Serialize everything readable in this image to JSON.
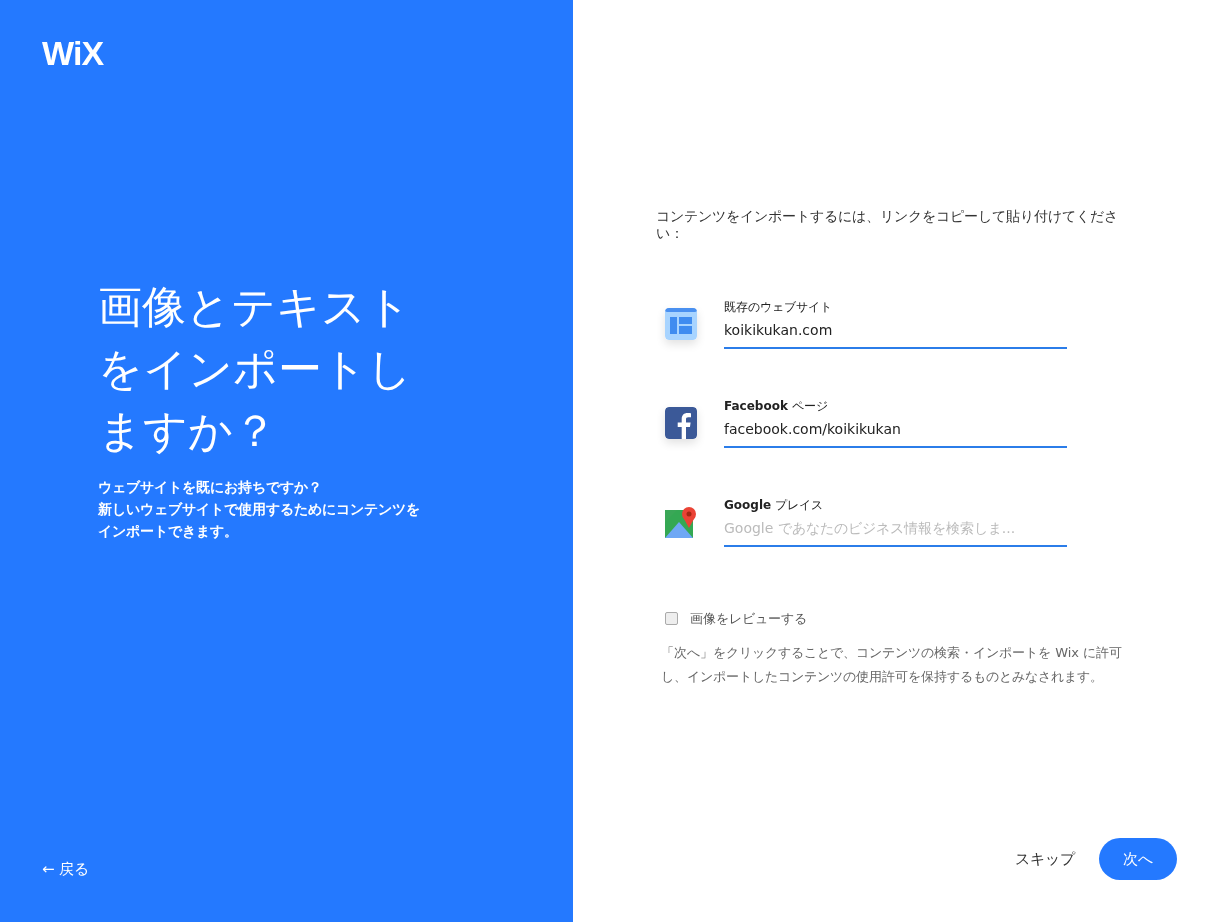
{
  "left_panel": {
    "logo": "WiX",
    "title": "画像とテキストをインポートしますか？",
    "subtitle": [
      "ウェブサイトを既にお持ちですか？",
      "新しいウェブサイトで使用するためにコンテンツを",
      "インポートできます。"
    ],
    "back_link": "← 戻る"
  },
  "right_panel": {
    "instruction": "コンテンツをインポートするには、リンクをコピーして貼り付けてください：",
    "fields": [
      {
        "kind": "website",
        "label": "既存のウェブサイト",
        "value": "koikikukan.com"
      },
      {
        "kind": "facebook",
        "label": "**Facebook** ページ",
        "value": "facebook.com/koikikukan"
      },
      {
        "kind": "google",
        "label": "**Google** プレイス",
        "placeholder": "Google であなたのビジネス情報を検索しま..."
      }
    ],
    "review_checkbox": {
      "label": "画像をレビューする",
      "checked": false
    },
    "disclaimer": "「次へ」をクリックすることで、コンテンツの検索・インポートを Wix に許可し、インポートしたコンテンツの使用許可を保持するものとみなされます。",
    "skip_button": "スキップ",
    "next_button": "次へ"
  }
}
